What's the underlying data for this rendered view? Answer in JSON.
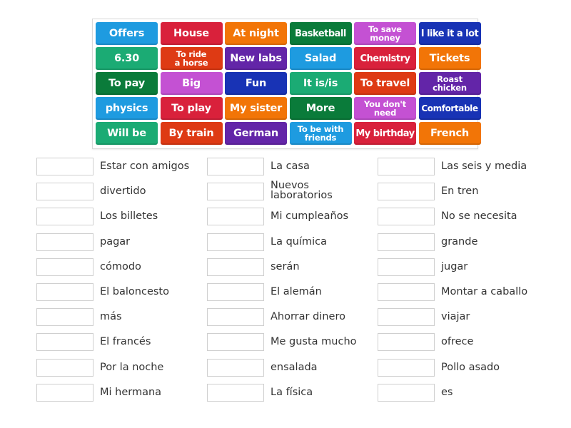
{
  "tiles": [
    {
      "label": "Offers",
      "color": "#1e9be0"
    },
    {
      "label": "House",
      "color": "#d9213b"
    },
    {
      "label": "At night",
      "color": "#f27507"
    },
    {
      "label": "Basketball",
      "color": "#0a7b3a"
    },
    {
      "label": "To save\nmoney",
      "color": "#c451d3"
    },
    {
      "label": "I like it a lot",
      "color": "#1833b5"
    },
    {
      "label": "6.30",
      "color": "#1bab74"
    },
    {
      "label": "To ride\na horse",
      "color": "#de3a14"
    },
    {
      "label": "New labs",
      "color": "#6325a8"
    },
    {
      "label": "Salad",
      "color": "#1e9be0"
    },
    {
      "label": "Chemistry",
      "color": "#d9213b"
    },
    {
      "label": "Tickets",
      "color": "#f27507"
    },
    {
      "label": "To pay",
      "color": "#0a7b3a"
    },
    {
      "label": "Big",
      "color": "#c451d3"
    },
    {
      "label": "Fun",
      "color": "#1833b5"
    },
    {
      "label": "It is/is",
      "color": "#1bab74"
    },
    {
      "label": "To travel",
      "color": "#de3a14"
    },
    {
      "label": "Roast\nchicken",
      "color": "#6325a8"
    },
    {
      "label": "physics",
      "color": "#1e9be0"
    },
    {
      "label": "To play",
      "color": "#d9213b"
    },
    {
      "label": "My sister",
      "color": "#f27507"
    },
    {
      "label": "More",
      "color": "#0a7b3a"
    },
    {
      "label": "You don't\nneed",
      "color": "#c451d3"
    },
    {
      "label": "Comfortable",
      "color": "#1833b5"
    },
    {
      "label": "Will be",
      "color": "#1bab74"
    },
    {
      "label": "By train",
      "color": "#de3a14"
    },
    {
      "label": "German",
      "color": "#6325a8"
    },
    {
      "label": "To be with\nfriends",
      "color": "#1e9be0"
    },
    {
      "label": "My birthday",
      "color": "#d9213b"
    },
    {
      "label": "French",
      "color": "#f27507"
    }
  ],
  "match_columns": [
    {
      "items": [
        {
          "label": "Estar con amigos"
        },
        {
          "label": "divertido"
        },
        {
          "label": "Los billetes"
        },
        {
          "label": "pagar"
        },
        {
          "label": "cómodo"
        },
        {
          "label": "El baloncesto"
        },
        {
          "label": "más"
        },
        {
          "label": "El francés"
        },
        {
          "label": "Por la noche"
        },
        {
          "label": "Mi hermana"
        }
      ]
    },
    {
      "items": [
        {
          "label": "La casa"
        },
        {
          "label": "Nuevos\nlaboratorios"
        },
        {
          "label": "Mi cumpleaños"
        },
        {
          "label": "La química"
        },
        {
          "label": "serán"
        },
        {
          "label": "El alemán"
        },
        {
          "label": "Ahorrar dinero"
        },
        {
          "label": "Me gusta mucho"
        },
        {
          "label": "ensalada"
        },
        {
          "label": "La física"
        }
      ]
    },
    {
      "items": [
        {
          "label": "Las seis y media"
        },
        {
          "label": "En tren"
        },
        {
          "label": "No se necesita"
        },
        {
          "label": "grande"
        },
        {
          "label": "jugar"
        },
        {
          "label": "Montar a caballo"
        },
        {
          "label": "viajar"
        },
        {
          "label": "ofrece"
        },
        {
          "label": "Pollo asado"
        },
        {
          "label": "es"
        }
      ]
    }
  ]
}
